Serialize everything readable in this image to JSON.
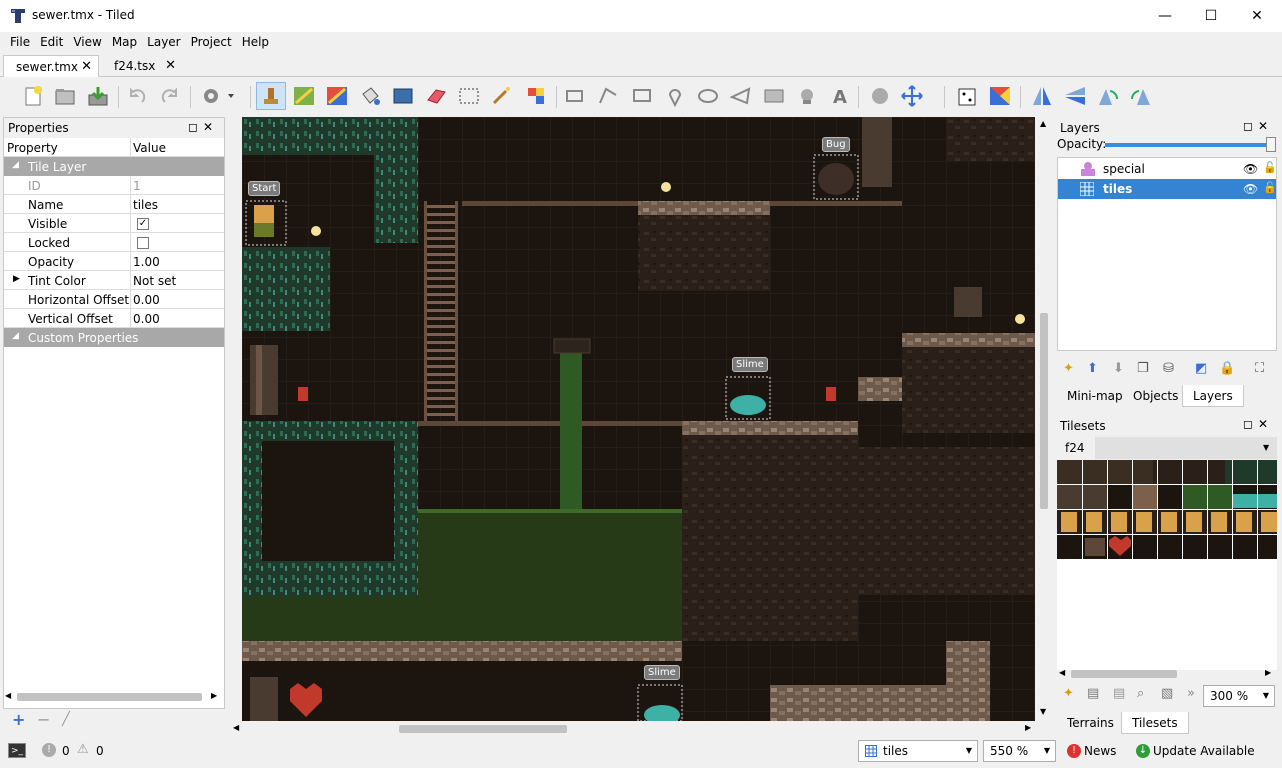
{
  "window": {
    "title": "sewer.tmx - Tiled",
    "minimize": "—",
    "maximize": "☐",
    "close": "✕"
  },
  "menu": [
    "File",
    "Edit",
    "View",
    "Map",
    "Layer",
    "Project",
    "Help"
  ],
  "tabs": [
    {
      "label": "sewer.tmx",
      "active": true
    },
    {
      "label": "f24.tsx",
      "active": false
    }
  ],
  "properties": {
    "title": "Properties",
    "col_property": "Property",
    "col_value": "Value",
    "group_tile_layer": "Tile Layer",
    "rows": [
      {
        "key": "ID",
        "value": "1"
      },
      {
        "key": "Name",
        "value": "tiles"
      },
      {
        "key": "Visible",
        "value": "✓"
      },
      {
        "key": "Locked",
        "value": ""
      },
      {
        "key": "Opacity",
        "value": "1.00"
      },
      {
        "key": "Tint Color",
        "value": "Not set"
      },
      {
        "key": "Horizontal Offset",
        "value": "0.00"
      },
      {
        "key": "Vertical Offset",
        "value": "0.00"
      }
    ],
    "group_custom": "Custom Properties"
  },
  "map_labels": {
    "start": "Start",
    "bug": "Bug",
    "slime1": "Slime",
    "slime2": "Slime"
  },
  "layers": {
    "title": "Layers",
    "opacity_label": "Opacity:",
    "items": [
      {
        "name": "special",
        "selected": false
      },
      {
        "name": "tiles",
        "selected": true
      }
    ],
    "tabs": [
      "Mini-map",
      "Objects",
      "Layers"
    ]
  },
  "tilesets": {
    "title": "Tilesets",
    "tab": "f24",
    "zoom": "300 %",
    "tabs": [
      "Terrains",
      "Tilesets"
    ]
  },
  "status": {
    "errors": "0",
    "warnings": "0",
    "layer": "tiles",
    "zoom": "550 %",
    "news": "News",
    "update": "Update Available"
  }
}
